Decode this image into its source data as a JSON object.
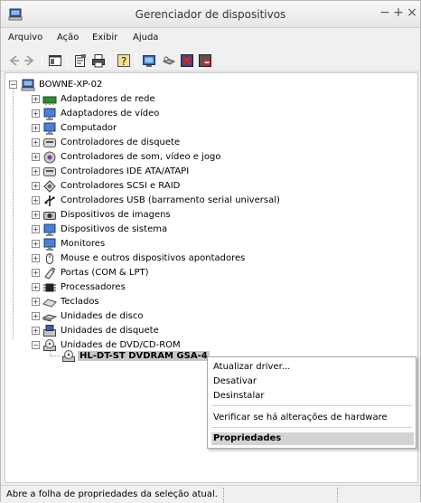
{
  "window": {
    "title": "Gerenciador de dispositivos",
    "minimize_glyph": "−",
    "maximize_glyph": "+",
    "close_glyph": "×"
  },
  "menubar": {
    "items": [
      "Arquivo",
      "Ação",
      "Exibir",
      "Ajuda"
    ]
  },
  "toolbar": {
    "icons": [
      "back-arrow-icon",
      "forward-arrow-icon",
      "show-hide-console-tree-icon",
      "properties-icon",
      "print-icon",
      "help-icon",
      "update-driver-icon",
      "scan-hardware-icon",
      "uninstall-icon",
      "disable-icon"
    ]
  },
  "tree": {
    "root": "BOWNE-XP-02",
    "categories": [
      "Adaptadores de rede",
      "Adaptadores de vídeo",
      "Computador",
      "Controladores de disquete",
      "Controladores de som, vídeo e jogo",
      "Controladores IDE ATA/ATAPI",
      "Controladores SCSI e RAID",
      "Controladores USB (barramento serial universal)",
      "Dispositivos de imagens",
      "Dispositivos de sistema",
      "Monitores",
      "Mouse e outros dispositivos apontadores",
      "Portas (COM & LPT)",
      "Processadores",
      "Teclados",
      "Unidades de disco",
      "Unidades de disquete",
      "Unidades de DVD/CD-ROM"
    ],
    "expanded_child": "HL-DT-ST DVDRAM GSA-4"
  },
  "context_menu": {
    "items": [
      "Atualizar driver...",
      "Desativar",
      "Desinstalar",
      "Verificar se há alterações de hardware",
      "Propriedades"
    ],
    "highlighted": "Propriedades"
  },
  "statusbar": {
    "text": "Abre a folha de propriedades da seleção atual."
  },
  "colors": {
    "selection_gray": "#c7c7c7",
    "menu_highlight": "#d3d3d3"
  }
}
